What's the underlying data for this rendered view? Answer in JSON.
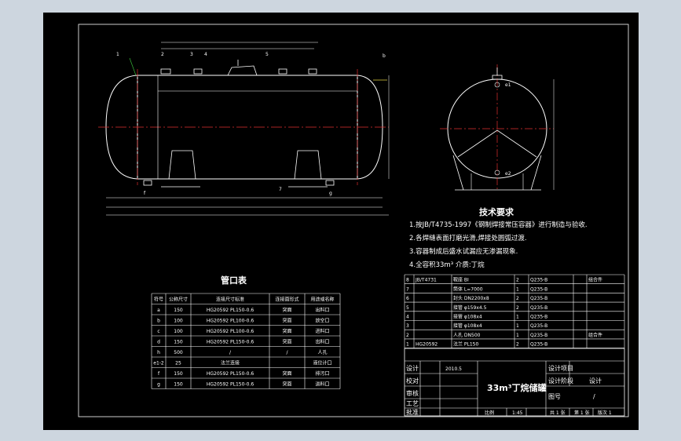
{
  "drawing_title": "33m³丁烷储罐",
  "tech_req": {
    "title": "技术要求",
    "items": [
      "1.按JB/T4735-1997《钢制焊接常压容器》进行制造与验收.",
      "2.各焊缝表面打磨光滑,焊接处圆弧过渡.",
      "3.容器制成后盛水试漏应无渗漏现象.",
      "4.全容积33m³  介质:丁烷"
    ]
  },
  "nozzle_table": {
    "title": "管口表",
    "headers": [
      "符号",
      "公称尺寸",
      "连接尺寸标准",
      "连接面形式",
      "用途或名称"
    ],
    "rows": [
      [
        "a",
        "150",
        "HG20592 PL150-0.6",
        "突面",
        "出料口"
      ],
      [
        "b",
        "100",
        "HG20592 PL100-0.6",
        "突面",
        "放空口"
      ],
      [
        "c",
        "100",
        "HG20592 PL100-0.6",
        "突面",
        "进料口"
      ],
      [
        "d",
        "150",
        "HG20592 PL150-0.6",
        "突面",
        "出料口"
      ],
      [
        "h",
        "500",
        "/",
        "/",
        "人孔"
      ],
      [
        "e1-2",
        "25",
        "法兰连接",
        "",
        "液位计口"
      ],
      [
        "f",
        "150",
        "HG20592 PL150-0.6",
        "突面",
        "排污口"
      ],
      [
        "g",
        "150",
        "HG20592 PL150-0.6",
        "突面",
        "进料口"
      ]
    ]
  },
  "bom": {
    "rows": [
      [
        "8",
        "JB/T4731",
        "鞍座 BI",
        "2",
        "Q235-B",
        "",
        "组合件"
      ],
      [
        "7",
        "",
        "筒体 L=7000",
        "1",
        "Q235-B",
        "",
        ""
      ],
      [
        "6",
        "",
        "封头 DN2200x8",
        "2",
        "Q235-B",
        "",
        ""
      ],
      [
        "5",
        "",
        "接管 φ159x4.5",
        "2",
        "Q235-B",
        "",
        ""
      ],
      [
        "4",
        "",
        "接管 φ108x4",
        "1",
        "Q235-B",
        "",
        ""
      ],
      [
        "3",
        "",
        "接管 φ108x4",
        "1",
        "Q235-B",
        "",
        ""
      ],
      [
        "2",
        "",
        "人孔 DN500",
        "1",
        "Q235-B",
        "",
        "组合件"
      ],
      [
        "1",
        "HG20592",
        "法兰 PL150",
        "2",
        "Q235-B",
        "",
        ""
      ]
    ]
  },
  "title_block": {
    "labels": [
      "设计",
      "校对",
      "审核",
      "工艺",
      "批准"
    ],
    "date_label": "2010.5",
    "scale_label": "比例",
    "scale_value": "1:45",
    "sheet_info": [
      "共 1 张",
      "第 1 张",
      "版次 1"
    ],
    "design_stage_label": "设计阶段",
    "design_stage_value": "设计",
    "project_label": "设计项目",
    "drawing_no_label": "图号",
    "drawing_no_value": "/"
  },
  "part_labels": [
    "1",
    "2",
    "3",
    "4",
    "5",
    "6",
    "7",
    "8"
  ],
  "nozzle_labels": [
    "a",
    "b",
    "c",
    "d",
    "e1",
    "e2",
    "f",
    "g",
    "h"
  ]
}
